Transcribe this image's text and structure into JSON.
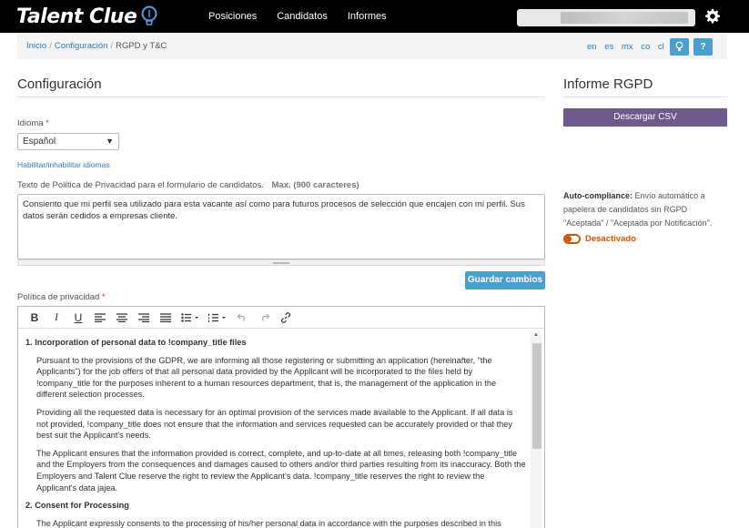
{
  "app": {
    "logo_text": "Talent Clue"
  },
  "nav": {
    "items": [
      "Posiciones",
      "Candidatos",
      "Informes"
    ]
  },
  "breadcrumb": {
    "home": "Inicio",
    "config": "Configuración",
    "current": "RGPD y T&C",
    "sep": "/"
  },
  "languages": [
    "en",
    "es",
    "mx",
    "co",
    "cl"
  ],
  "header_buttons": {
    "tip_icon": "lightbulb-icon",
    "help_label": "?"
  },
  "config": {
    "title": "Configuración",
    "language_label": "Idioma",
    "required_mark": "*",
    "language_value": "Español",
    "enable_languages_link": "Habilitar/inhabilitar idiomas",
    "privacy_text_label": "Texto de Política de Privacidad para el formulario de candidatos.",
    "privacy_text_max": "Max. (900 caracteres)",
    "privacy_text_value": "Consiento que mi perfil sea utilizado para esta vacante así como para futuros procesos de selección que encajen con mi perfil. Sus datos serán cedidos a empresas cliente.",
    "save_button": "Guardar cambios",
    "policy_label": "Política de privacidad"
  },
  "editor": {
    "toolbar": [
      "bold-icon",
      "italic-icon",
      "underline-icon",
      "align-left-icon",
      "align-center-icon",
      "align-right-icon",
      "align-justify-icon",
      "bullet-list-icon",
      "numbered-list-icon",
      "undo-icon",
      "redo-icon",
      "link-icon"
    ],
    "sections": [
      {
        "title": "1. Incorporation of personal data to !company_title files",
        "paragraphs": [
          "Pursuant to the provisions of the GDPR, we are informing all those registering or submitting an application (hereinafter, \"the Applicants\") for the job offers of that all personal data provided by the Applicant will be incorporated to the files held by !company_title for the purposes inherent to a human resources department, that is, the management of the application in the different selection processes.",
          "Providing all the requested data is necessary for an optimal provision of the services made available to the Applicant. If all data is not provided, !company_title does not ensure that the information and services requested can be accurately provided or that they best suit the Applicant's needs.",
          "The Applicant ensures that the information provided is correct, complete, and up-to-date at all times, releasing both !company_title and the Employers from the consequences and damages caused to others and/or third parties resulting from its inaccuracy. Both the Employers and Talent Clue reserve the right to review the Applicant's data. !company_title reserves the right to review the Applicant's data jajea."
        ]
      },
      {
        "title": "2. Consent for Processing",
        "paragraphs": [
          "The Applicant expressly consents to the processing of his/her personal data in accordance with the purposes described in this"
        ]
      }
    ]
  },
  "rgpd": {
    "title": "Informe RGPD",
    "download_button": "Descargar CSV",
    "auto_label": "Auto-compliance:",
    "auto_desc": "Envío automático a papelera de candidatos sin RGPD \"Aceptada\" / \"Aceptada por Notificación\".",
    "toggle_state": "Desactivado",
    "toggle_on": false
  },
  "colors": {
    "topbar": "#000000",
    "accent": "#4a9fd1",
    "csv_button": "#6e5a8c",
    "toggle_off": "#d35400"
  }
}
